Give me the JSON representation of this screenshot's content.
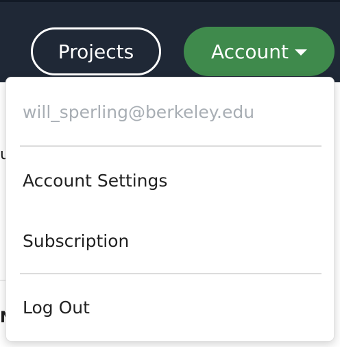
{
  "navbar": {
    "projects_label": "Projects",
    "account_label": "Account",
    "account_caret_icon": "caret-down-icon",
    "background_color": "#1f2836",
    "account_color": "#3f8a4c"
  },
  "dropdown": {
    "email": "will_sperling@berkeley.edu",
    "items": [
      {
        "label": "Account Settings"
      },
      {
        "label": "Subscription"
      },
      {
        "label": "Log Out"
      }
    ]
  }
}
